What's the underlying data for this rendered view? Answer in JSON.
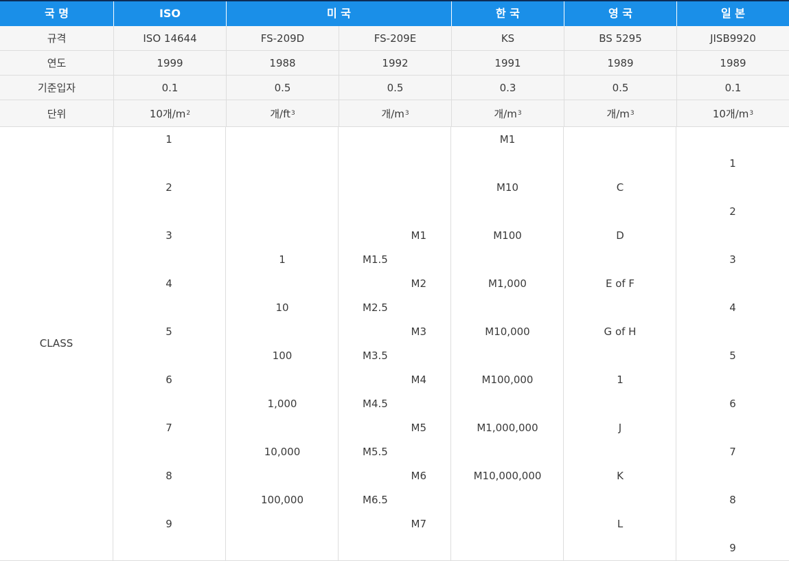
{
  "header": [
    "국 명",
    "ISO",
    "미 국",
    "한 국",
    "영 국",
    "일 본"
  ],
  "rows": [
    {
      "label": "규격",
      "values": [
        "ISO 14644",
        "FS-209D",
        "FS-209E",
        "KS",
        "BS 5295",
        "JISB9920"
      ]
    },
    {
      "label": "연도",
      "values": [
        "1999",
        "1988",
        "1992",
        "1991",
        "1989",
        "1989"
      ]
    },
    {
      "label": "기준입자",
      "values": [
        "0.1",
        "0.5",
        "0.5",
        "0.3",
        "0.5",
        "0.1"
      ]
    }
  ],
  "unit_row": {
    "label": "단위",
    "values": [
      {
        "base": "10개/m",
        "sup": "2"
      },
      {
        "base": "개/ft",
        "sup": "3"
      },
      {
        "base": "개/m",
        "sup": "3"
      },
      {
        "base": "개/m",
        "sup": "3"
      },
      {
        "base": "개/m",
        "sup": "3"
      },
      {
        "base": "10개/m",
        "sup": "3"
      }
    ]
  },
  "class_label": "CLASS",
  "classes": {
    "iso": [
      "1",
      "2",
      "3",
      "4",
      "5",
      "6",
      "7",
      "8",
      "9"
    ],
    "fs209d": [
      "1",
      "10",
      "100",
      "1,000",
      "10,000",
      "100,000"
    ],
    "fs209e_half": [
      "M1.5",
      "M2.5",
      "M3.5",
      "M4.5",
      "M5.5",
      "M6.5"
    ],
    "fs209e_whole": [
      "M1",
      "M2",
      "M3",
      "M4",
      "M5",
      "M6",
      "M7"
    ],
    "ks": [
      "M1",
      "M10",
      "M100",
      "M1,000",
      "M10,000",
      "M100,000",
      "M1,000,000",
      "M10,000,000"
    ],
    "bs5295": [
      "C",
      "D",
      "E of F",
      "G of H",
      "1",
      "J",
      "K",
      "L"
    ],
    "jis": [
      "1",
      "2",
      "3",
      "4",
      "5",
      "6",
      "7",
      "8",
      "9"
    ]
  }
}
